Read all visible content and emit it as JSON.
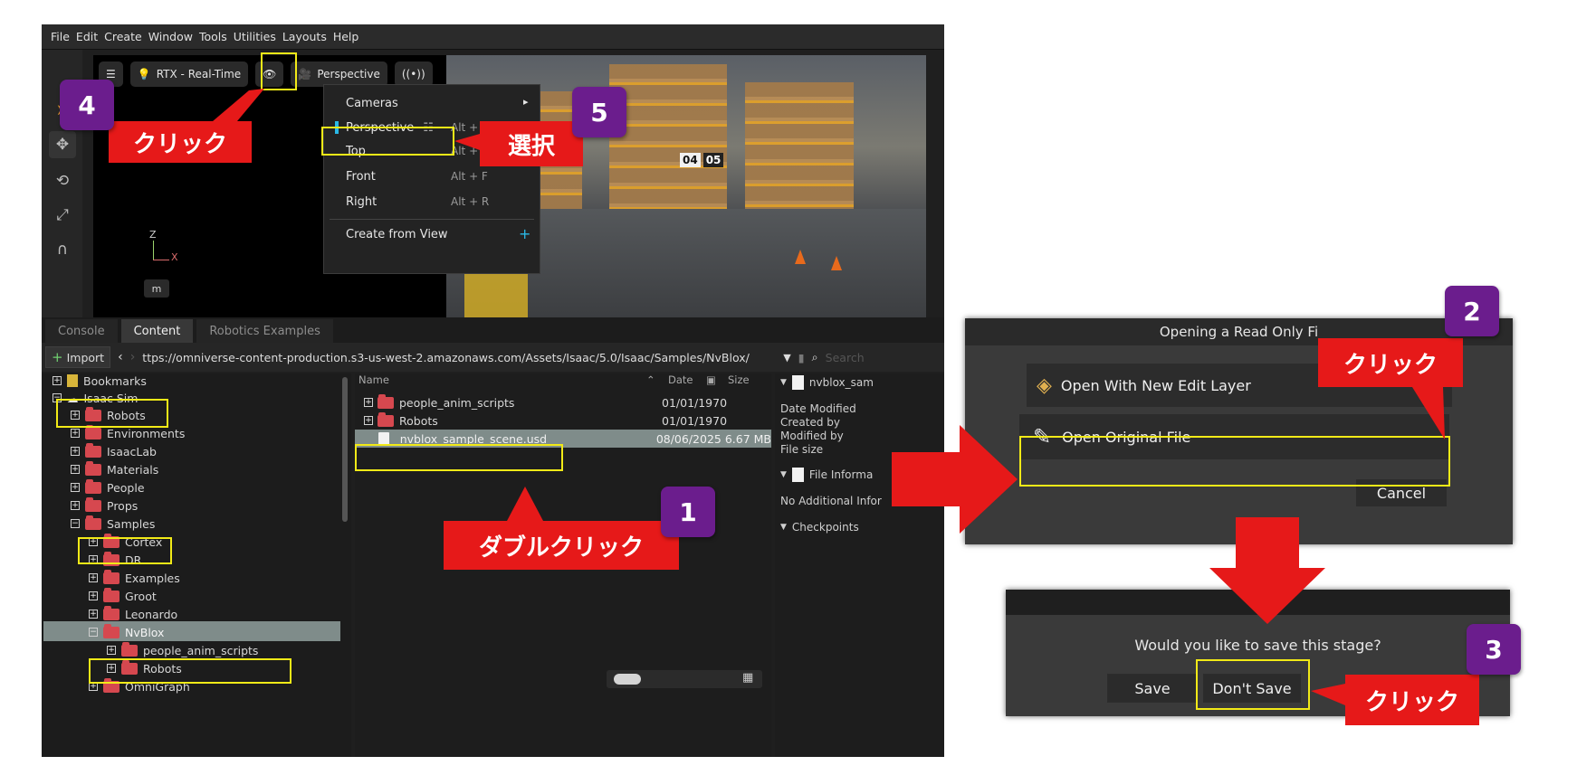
{
  "menubar": [
    "File",
    "Edit",
    "Create",
    "Window",
    "Tools",
    "Utilities",
    "Layouts",
    "Help"
  ],
  "viewport": {
    "renderer_label": "RTX - Real-Time",
    "camera_label": "Perspective",
    "axis_z": "Z",
    "axis_x": "X",
    "unit_button": "m",
    "rack_labels": [
      "04",
      "05"
    ],
    "camera_menu": {
      "cameras": "Cameras",
      "perspective": "Perspective",
      "perspective_shortcut": "Alt + P",
      "top": "Top",
      "top_shortcut": "Alt + T",
      "front": "Front",
      "front_shortcut": "Alt + F",
      "right": "Right",
      "right_shortcut": "Alt + R",
      "create_from_view": "Create from View"
    }
  },
  "tabs": [
    "Console",
    "Content",
    "Robotics Examples"
  ],
  "pathbar": {
    "import_label": "Import",
    "path": "ttps://omniverse-content-production.s3-us-west-2.amazonaws.com/Assets/Isaac/5.0/Isaac/Samples/NvBlox/",
    "search_placeholder": "Search"
  },
  "tree": {
    "bookmarks": "Bookmarks",
    "isaac_sim": "Isaac Sim",
    "robots": "Robots",
    "environments": "Environments",
    "isaaclab": "IsaacLab",
    "materials": "Materials",
    "people": "People",
    "props": "Props",
    "samples": "Samples",
    "cortex": "Cortex",
    "dr": "DR",
    "examples": "Examples",
    "groot": "Groot",
    "leonardo": "Leonardo",
    "nvblox": "NvBlox",
    "people_anim_scripts": "people_anim_scripts",
    "robots_sub": "Robots",
    "omnigraph": "OmniGraph"
  },
  "filelist": {
    "col_name": "Name",
    "col_date": "Date",
    "col_size": "Size",
    "rows": [
      {
        "name": "people_anim_scripts",
        "date": "01/01/1970"
      },
      {
        "name": "Robots",
        "date": "01/01/1970"
      },
      {
        "name": "nvblox_sample_scene.usd",
        "date": "08/06/2025 6.67 MB"
      }
    ]
  },
  "details": {
    "file_name": "nvblox_sam",
    "date_modified": "Date Modified",
    "created_by": "Created by",
    "modified_by": "Modified by",
    "file_size": "File size",
    "file_information": "File Informa",
    "no_additional": "No Additional Infor",
    "checkpoints": "Checkpoints"
  },
  "dialog_open": {
    "title": "Opening a Read Only Fi",
    "new_edit_layer": "Open With New Edit Layer",
    "original_file": "Open Original File",
    "cancel": "Cancel"
  },
  "dialog_save": {
    "question": "Would you like to save this stage?",
    "save": "Save",
    "dont_save": "Don't Save"
  },
  "annotations": {
    "badge_1": "1",
    "badge_2": "2",
    "badge_3": "3",
    "badge_4": "4",
    "badge_5": "5",
    "label_double_click": "ダブルクリック",
    "label_click_4": "クリック",
    "label_select_5": "選択",
    "label_click_2": "クリック",
    "label_click_3": "クリック"
  },
  "colors": {
    "highlight": "#f2ea17",
    "label_red": "#e61919",
    "badge_purple": "#6b1d8d",
    "arrow_red": "#e61919"
  }
}
